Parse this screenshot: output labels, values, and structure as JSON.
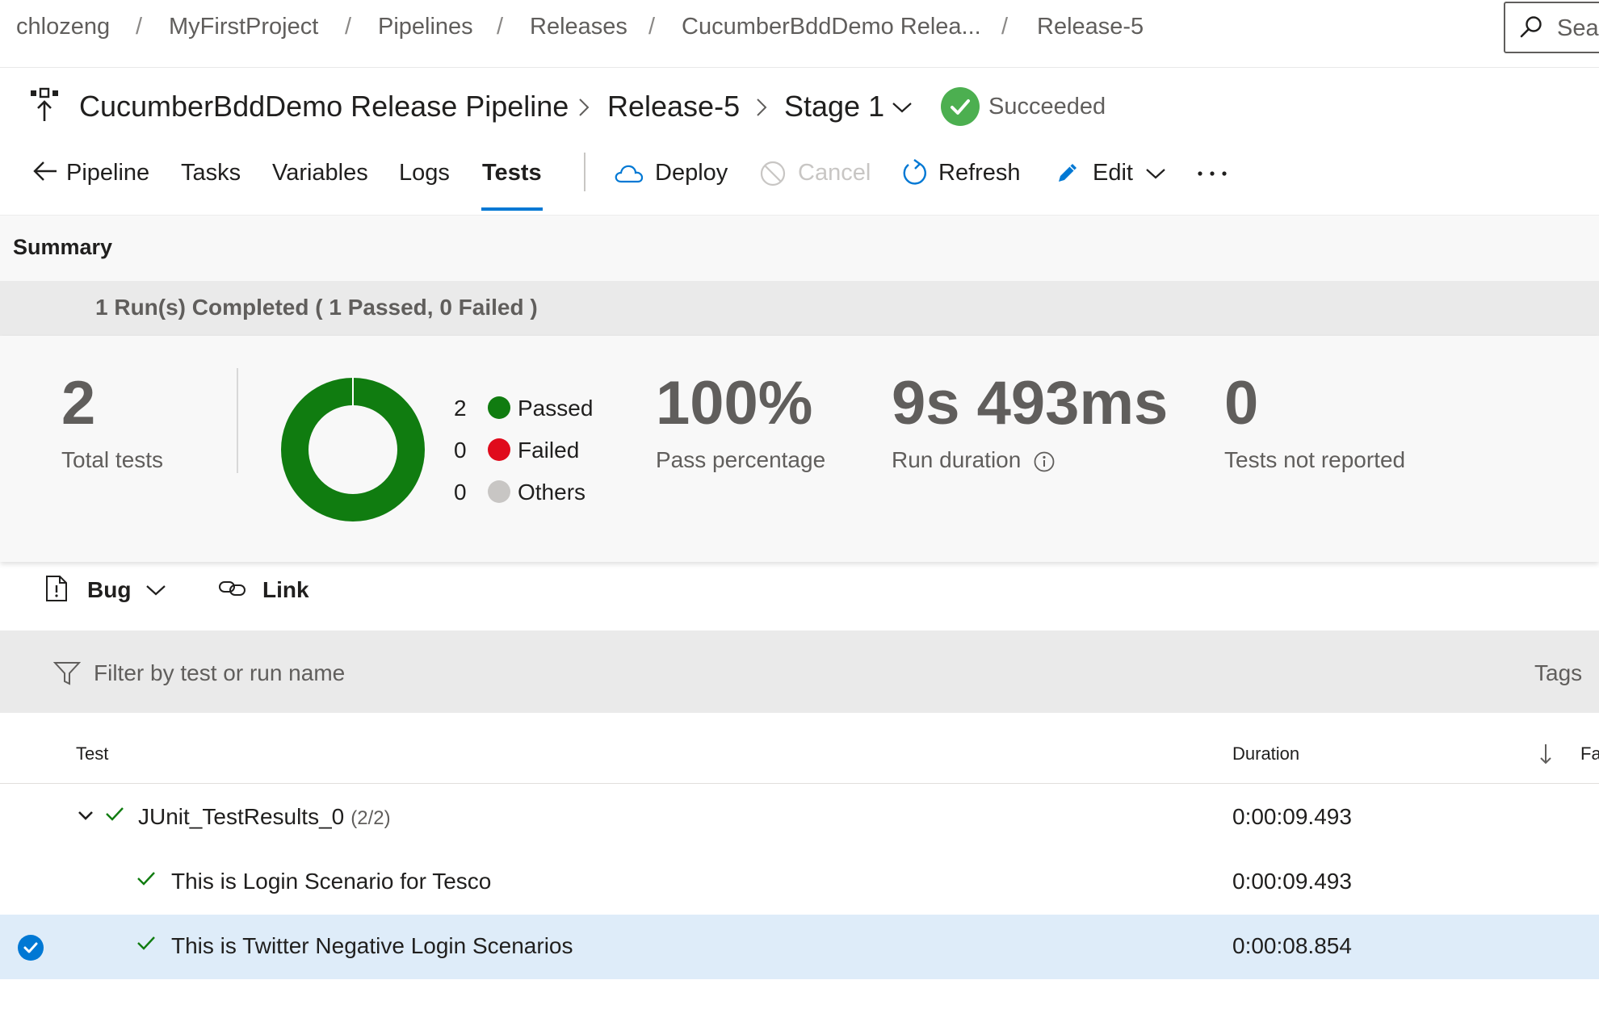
{
  "breadcrumb": [
    "chlozeng",
    "MyFirstProject",
    "Pipelines",
    "Releases",
    "CucumberBddDemo Relea...",
    "Release-5"
  ],
  "search": {
    "label": "Sear"
  },
  "title": {
    "pipeline": "CucumberBddDemo Release Pipeline",
    "release": "Release-5",
    "stage": "Stage 1",
    "status": "Succeeded"
  },
  "tabs": [
    "Pipeline",
    "Tasks",
    "Variables",
    "Logs",
    "Tests"
  ],
  "active_tab": "Tests",
  "commands": {
    "deploy": "Deploy",
    "cancel": "Cancel",
    "refresh": "Refresh",
    "edit": "Edit"
  },
  "summary": {
    "title": "Summary",
    "runs_text": "1 Run(s) Completed ( 1 Passed, 0 Failed )",
    "total": {
      "value": "2",
      "label": "Total tests"
    },
    "legend": [
      {
        "count": "2",
        "label": "Passed",
        "color": "#107c10"
      },
      {
        "count": "0",
        "label": "Failed",
        "color": "#e00b1c"
      },
      {
        "count": "0",
        "label": "Others",
        "color": "#c8c6c4"
      }
    ],
    "pass": {
      "value": "100%",
      "label": "Pass percentage"
    },
    "duration": {
      "value": "9s 493ms",
      "label": "Run duration"
    },
    "not_reported": {
      "value": "0",
      "label": "Tests not reported"
    }
  },
  "chart_data": {
    "type": "pie",
    "categories": [
      "Passed",
      "Failed",
      "Others"
    ],
    "values": [
      2,
      0,
      0
    ],
    "colors": [
      "#107c10",
      "#e00b1c",
      "#c8c6c4"
    ]
  },
  "toolbar2": {
    "bug": "Bug",
    "link": "Link"
  },
  "filter": {
    "placeholder": "Filter by test or run name",
    "tags": "Tags"
  },
  "table": {
    "headers": {
      "test": "Test",
      "duration": "Duration",
      "failing": "Fa"
    },
    "group": {
      "name": "JUnit_TestResults_0",
      "count": "(2/2)",
      "duration": "0:00:09.493"
    },
    "rows": [
      {
        "name": "This is Login Scenario for Tesco",
        "duration": "0:00:09.493",
        "selected": false
      },
      {
        "name": "This is Twitter Negative Login Scenarios",
        "duration": "0:00:08.854",
        "selected": true
      }
    ]
  },
  "colors": {
    "accent": "#0078d4",
    "success": "#107c10",
    "failed": "#e00b1c",
    "status_badge": "#4caf50"
  }
}
